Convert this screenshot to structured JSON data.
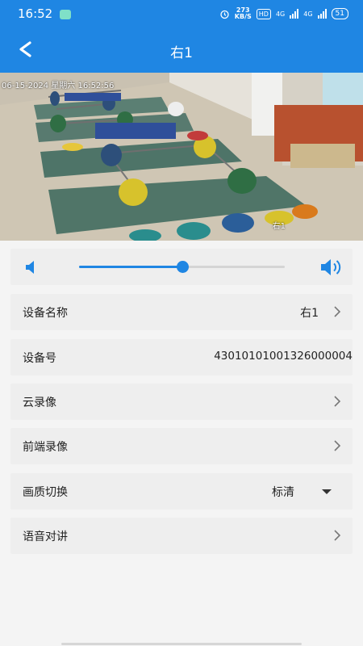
{
  "status_bar": {
    "time": "16:52",
    "net_speed_value": "273",
    "net_speed_unit": "KB/S",
    "hd_label": "HD",
    "network_1": "4G",
    "network_2": "4G",
    "battery": "51"
  },
  "header": {
    "title": "右1"
  },
  "video": {
    "osd_timestamp": "06-15-2024 星期六 16:52:56",
    "camera_label": "右1"
  },
  "volume": {
    "level": 0.5
  },
  "settings": {
    "device_name": {
      "label": "设备名称",
      "value": "右1"
    },
    "device_number": {
      "label": "设备号",
      "value": "43010101001326000004"
    },
    "cloud_recording": {
      "label": "云录像"
    },
    "local_recording": {
      "label": "前端录像"
    },
    "quality": {
      "label": "画质切换",
      "value": "标清"
    },
    "voice_talk": {
      "label": "语音对讲"
    }
  },
  "colors": {
    "accent": "#1f86e3",
    "row_background": "#eeeeee"
  }
}
